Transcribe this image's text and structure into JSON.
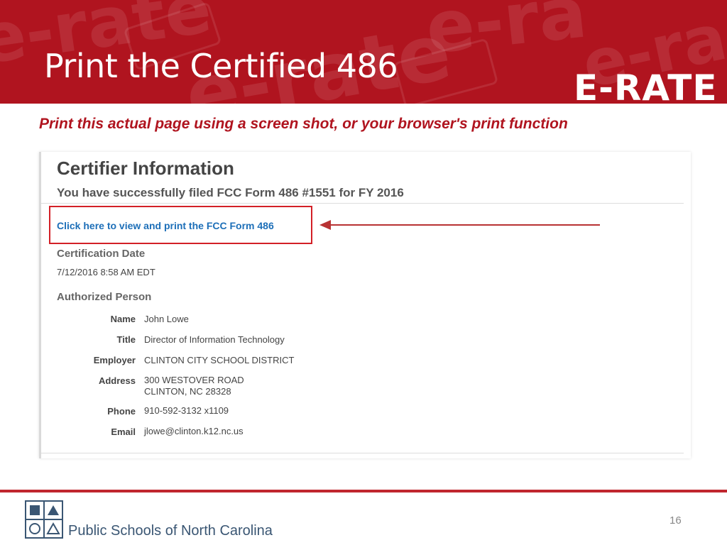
{
  "slide": {
    "title": "Print the Certified 486",
    "logo": "E-RATE",
    "instruction": "Print this actual page using a screen shot, or your browser's print function",
    "page_number": "16",
    "footer_org": "Public Schools of North Carolina"
  },
  "screenshot": {
    "heading": "Certifier Information",
    "filed_message": "You have successfully filed FCC Form 486 #1551 for FY 2016",
    "print_link": "Click here to view and print the FCC Form 486",
    "certification_date_label": "Certification Date",
    "certification_date": "7/12/2016 8:58 AM EDT",
    "authorized_person_label": "Authorized Person",
    "fields": {
      "name": {
        "label": "Name",
        "value": "John Lowe"
      },
      "title": {
        "label": "Title",
        "value": "Director of Information Technology"
      },
      "employer": {
        "label": "Employer",
        "value": "CLINTON CITY SCHOOL DISTRICT"
      },
      "address": {
        "label": "Address",
        "line1": "300 WESTOVER ROAD",
        "line2": "CLINTON, NC 28328"
      },
      "phone": {
        "label": "Phone",
        "value": "910-592-3132 x1109"
      },
      "email": {
        "label": "Email",
        "value": "jlowe@clinton.k12.nc.us"
      }
    }
  },
  "colors": {
    "banner": "#b0141f",
    "accent_red": "#d32027",
    "link_blue": "#1d6fb8"
  }
}
